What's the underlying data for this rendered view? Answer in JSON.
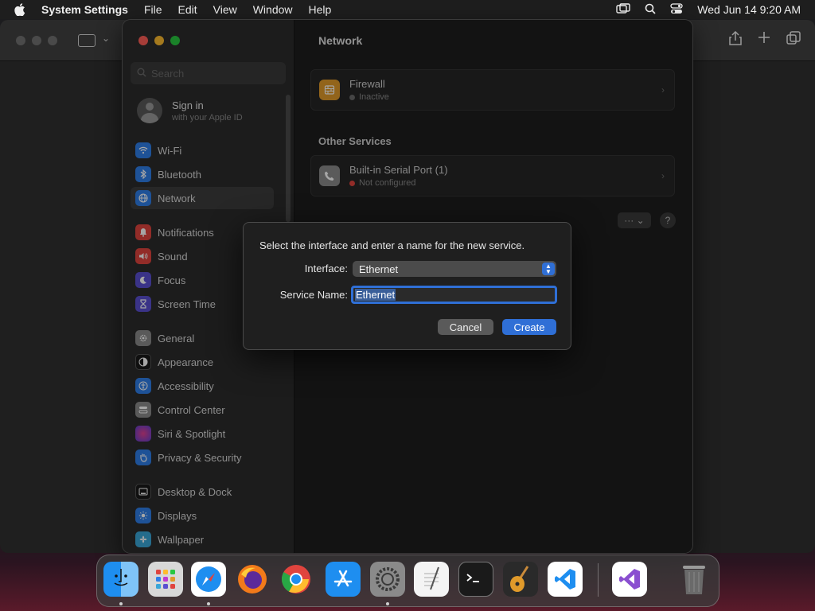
{
  "menubar": {
    "app_name": "System Settings",
    "items": [
      "File",
      "Edit",
      "View",
      "Window",
      "Help"
    ],
    "datetime": "Wed Jun 14  9:20 AM"
  },
  "sidebar": {
    "search_placeholder": "Search",
    "signin_title": "Sign in",
    "signin_subtitle": "with your Apple ID",
    "items": [
      {
        "label": "Wi-Fi",
        "color": "#2f7ee8"
      },
      {
        "label": "Bluetooth",
        "color": "#2f7ee8"
      },
      {
        "label": "Network",
        "color": "#2f7ee8"
      },
      {
        "label": "Notifications",
        "color": "#e0443e"
      },
      {
        "label": "Sound",
        "color": "#e0443e"
      },
      {
        "label": "Focus",
        "color": "#5a4fd0"
      },
      {
        "label": "Screen Time",
        "color": "#5a4fd0"
      },
      {
        "label": "General",
        "color": "#8a8a8a"
      },
      {
        "label": "Appearance",
        "color": "#1a1a1a"
      },
      {
        "label": "Accessibility",
        "color": "#2f7ee8"
      },
      {
        "label": "Control Center",
        "color": "#8a8a8a"
      },
      {
        "label": "Siri & Spotlight",
        "color": "#c13ad0"
      },
      {
        "label": "Privacy & Security",
        "color": "#2f7ee8"
      },
      {
        "label": "Desktop & Dock",
        "color": "#1a1a1a"
      },
      {
        "label": "Displays",
        "color": "#2f7ee8"
      },
      {
        "label": "Wallpaper",
        "color": "#3aa6d8"
      }
    ]
  },
  "main": {
    "title": "Network",
    "firewall": {
      "title": "Firewall",
      "status": "Inactive"
    },
    "other_services_title": "Other Services",
    "serial": {
      "title": "Built-in Serial Port (1)",
      "status": "Not configured"
    },
    "more_label": "···",
    "help_label": "?"
  },
  "dialog": {
    "prompt": "Select the interface and enter a name for the new service.",
    "interface_label": "Interface:",
    "interface_value": "Ethernet",
    "service_name_label": "Service Name:",
    "service_name_value": "Ethernet",
    "cancel_label": "Cancel",
    "create_label": "Create"
  },
  "dock": {
    "apps": [
      "finder-icon",
      "launchpad-icon",
      "safari-icon",
      "firefox-icon",
      "chrome-icon",
      "app-store-icon",
      "system-settings-icon",
      "textedit-icon",
      "terminal-icon",
      "garageband-icon",
      "vscode-icon",
      "visual-studio-icon",
      "trash-icon"
    ]
  },
  "colors": {
    "accent": "#2f6fd6",
    "traffic_red": "#ff5f57",
    "traffic_yellow": "#febc2e",
    "traffic_green": "#28c840"
  }
}
